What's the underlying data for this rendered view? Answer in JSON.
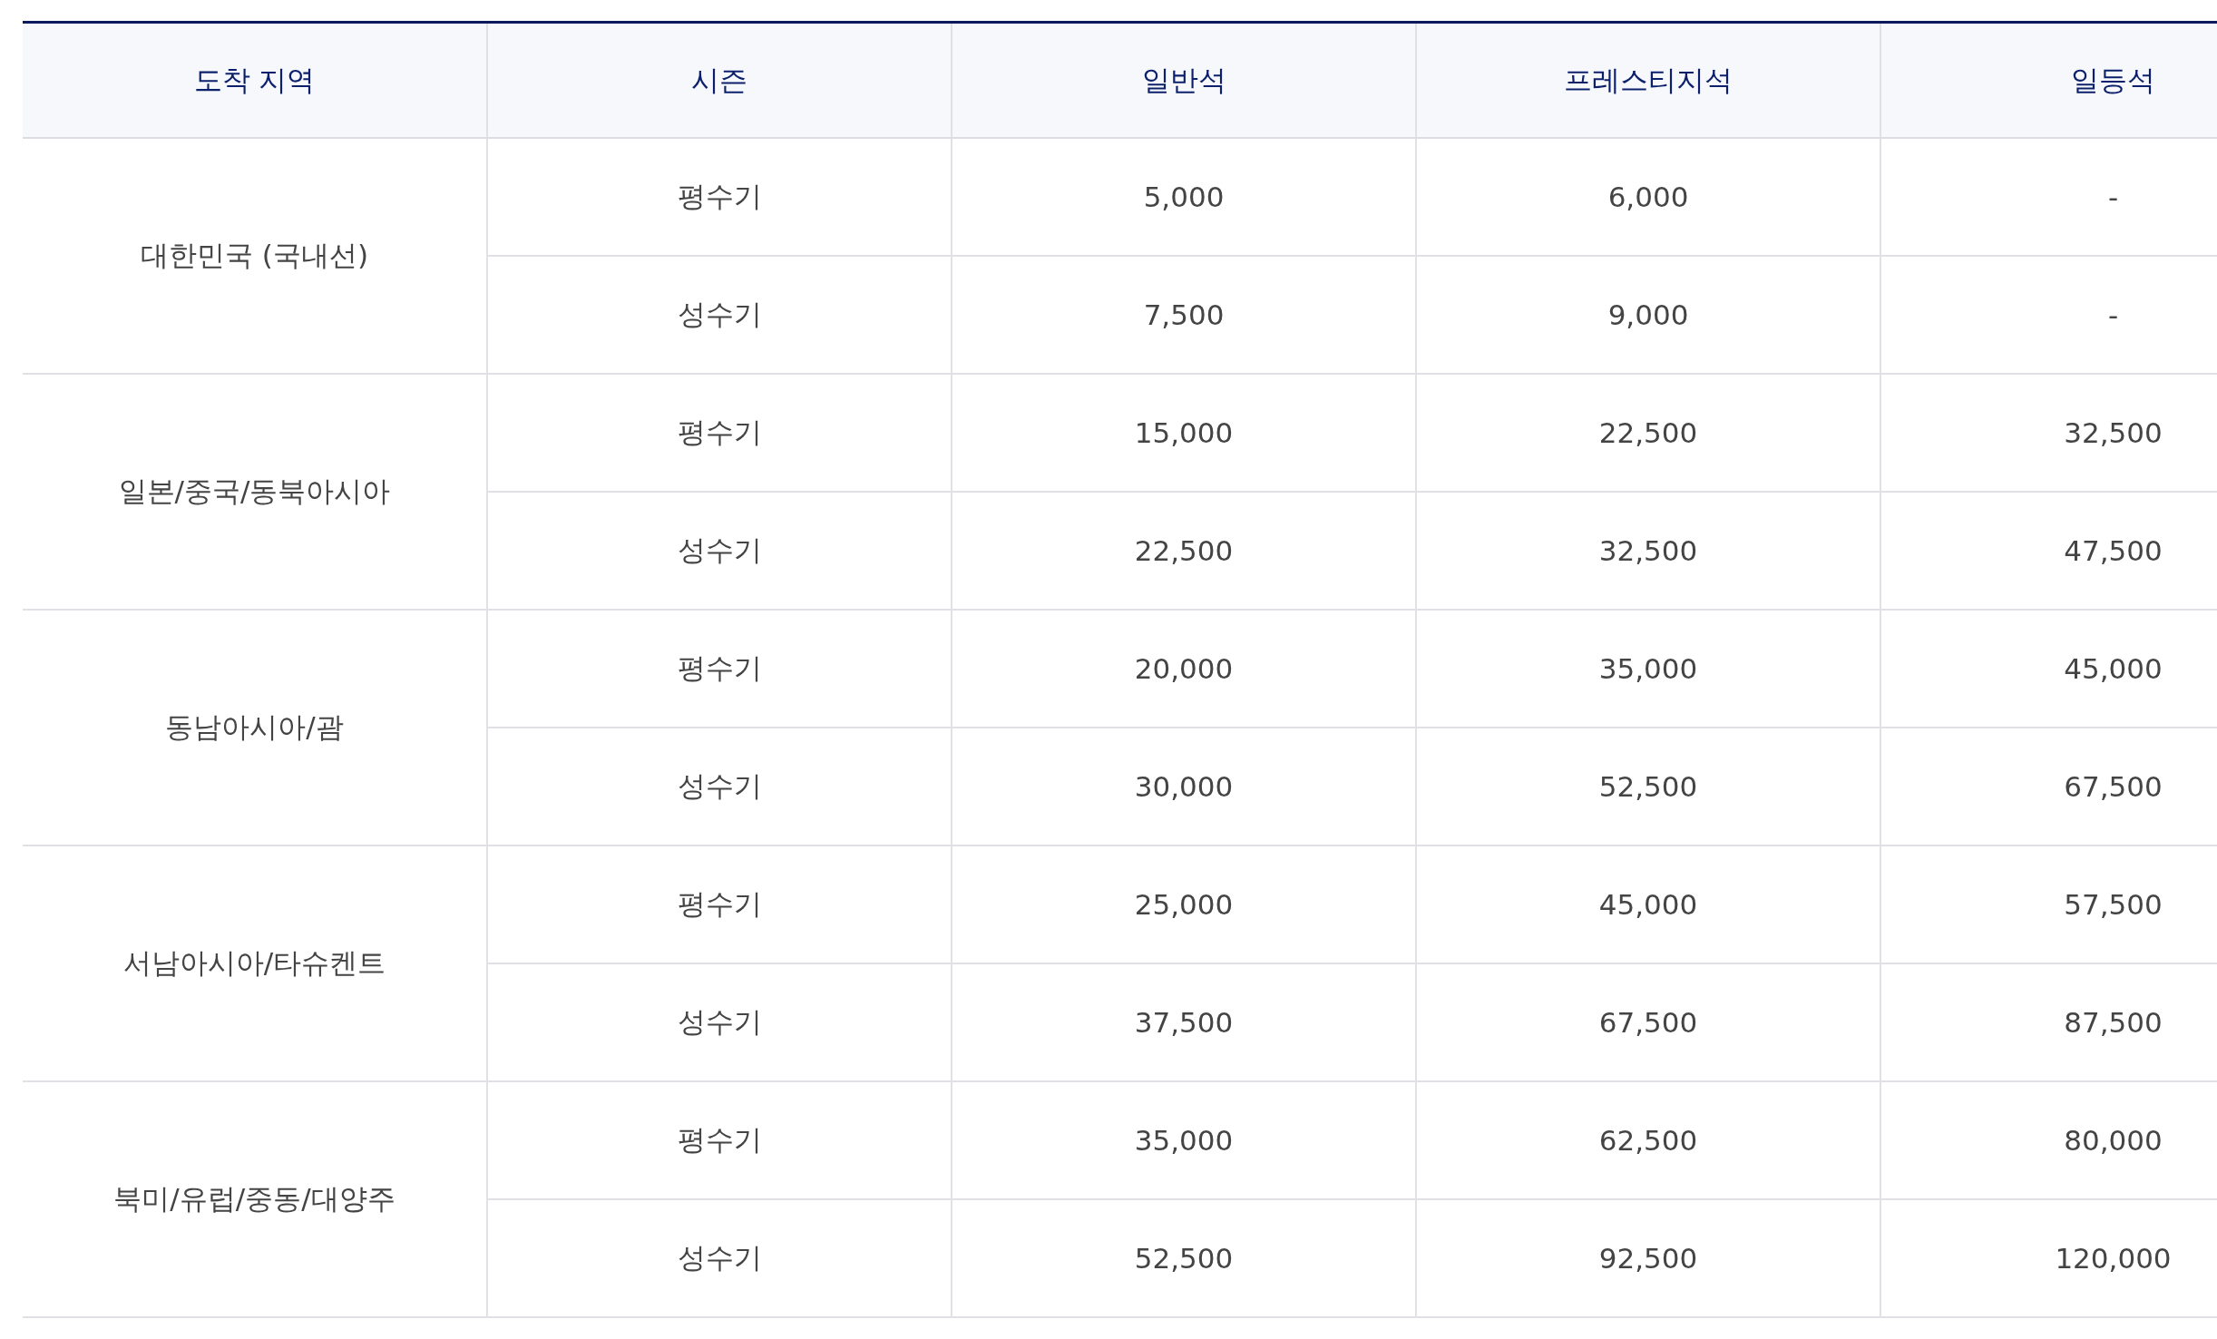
{
  "table": {
    "columns": [
      "도착 지역",
      "시즌",
      "일반석",
      "프레스티지석",
      "일등석"
    ],
    "groups": [
      {
        "region": "대한민국 (국내선)",
        "rows": [
          {
            "cells": [
              "평수기",
              "5,000",
              "6,000",
              "-"
            ]
          },
          {
            "cells": [
              "성수기",
              "7,500",
              "9,000",
              "-"
            ]
          }
        ]
      },
      {
        "region": "일본/중국/동북아시아",
        "rows": [
          {
            "cells": [
              "평수기",
              "15,000",
              "22,500",
              "32,500"
            ]
          },
          {
            "cells": [
              "성수기",
              "22,500",
              "32,500",
              "47,500"
            ]
          }
        ]
      },
      {
        "region": "동남아시아/괌",
        "rows": [
          {
            "cells": [
              "평수기",
              "20,000",
              "35,000",
              "45,000"
            ]
          },
          {
            "cells": [
              "성수기",
              "30,000",
              "52,500",
              "67,500"
            ]
          }
        ]
      },
      {
        "region": "서남아시아/타슈켄트",
        "rows": [
          {
            "cells": [
              "평수기",
              "25,000",
              "45,000",
              "57,500"
            ]
          },
          {
            "cells": [
              "성수기",
              "37,500",
              "67,500",
              "87,500"
            ]
          }
        ]
      },
      {
        "region": "북미/유럽/중동/대양주",
        "rows": [
          {
            "cells": [
              "평수기",
              "35,000",
              "62,500",
              "80,000"
            ]
          },
          {
            "cells": [
              "성수기",
              "52,500",
              "92,500",
              "120,000"
            ]
          }
        ]
      }
    ]
  }
}
